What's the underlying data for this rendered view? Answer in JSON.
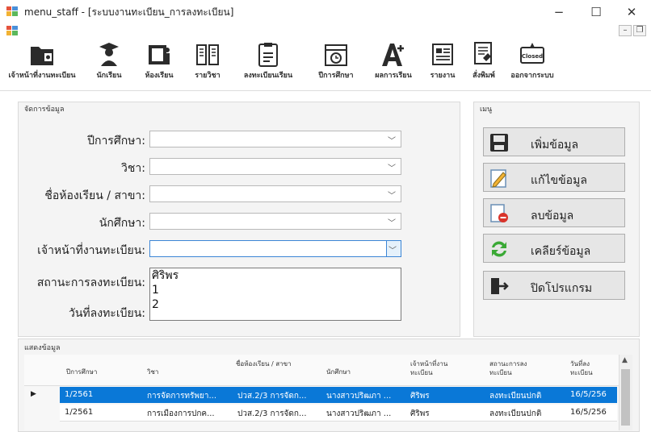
{
  "window": {
    "title": "menu_staff - [ระบบงานทะเบียน_การลงทะเบียน]",
    "minimize": "−",
    "maximize": "☐",
    "close": "✕",
    "mdi_min": "–",
    "mdi_restore": "❐"
  },
  "toolbar": {
    "items": [
      {
        "label": "เจ้าหน้าที่งานทะเบียน",
        "icon": "folder-icon"
      },
      {
        "label": "นักเรียน",
        "icon": "graduate-icon"
      },
      {
        "label": "ห้องเรียน",
        "icon": "classroom-icon"
      },
      {
        "label": "รายวิชา",
        "icon": "book-icon"
      },
      {
        "label": "ลงทะเบียนเรียน",
        "icon": "clipboard-icon"
      },
      {
        "label": "ปีการศึกษา",
        "icon": "calendar-icon"
      },
      {
        "label": "ผลการเรียน",
        "icon": "grade-icon"
      },
      {
        "label": "รายงาน",
        "icon": "report-icon"
      },
      {
        "label": "สั่งพิมพ์",
        "icon": "print-icon"
      },
      {
        "label": "ออกจากระบบ",
        "icon": "closed-sign-icon"
      }
    ],
    "closed_sign_text": "Closed"
  },
  "form": {
    "group_title": "จัดการข้อมูล",
    "fields": [
      {
        "label": "ปีการศึกษา:",
        "value": ""
      },
      {
        "label": "วิชา:",
        "value": ""
      },
      {
        "label": "ชื่อห้องเรียน / สาขา:",
        "value": ""
      },
      {
        "label": "นักศึกษา:",
        "value": ""
      },
      {
        "label": "เจ้าหน้าที่งานทะเบียน:",
        "value": ""
      },
      {
        "label": "สถานะการลงทะเบียน:",
        "value": ""
      },
      {
        "label": "วันที่ลงทะเบียน:",
        "value": ""
      }
    ],
    "dropdown_options": [
      "ศิริพร",
      "1",
      "2"
    ]
  },
  "menu": {
    "group_title": "เมนู",
    "buttons": [
      {
        "label": "เพิ่มข้อมูล",
        "icon": "save-icon"
      },
      {
        "label": "แก้ไขข้อมูล",
        "icon": "edit-icon"
      },
      {
        "label": "ลบข้อมูล",
        "icon": "delete-icon"
      },
      {
        "label": "เคลียร์ข้อมูล",
        "icon": "refresh-icon"
      },
      {
        "label": "ปิดโปรแกรม",
        "icon": "exit-icon"
      }
    ]
  },
  "grid": {
    "group_title": "แสดงข้อมูล",
    "headers": [
      "ปีการศึกษา",
      "วิชา",
      "ชื่อห้องเรียน / สาขา",
      "นักศึกษา",
      "เจ้าหน้าที่งาน ทะเบียน",
      "สถานะการลง ทะเบียน",
      "วันที่ลง ทะเบียน"
    ],
    "rows": [
      {
        "selected": true,
        "cells": [
          "1/2561",
          "การจัดการทรัพยา...",
          "ปวส.2/3 การจัดก...",
          "นางสาวปริฒภา ...",
          "ศิริพร",
          "ลงทะเบียนปกติ",
          "16/5/256"
        ]
      },
      {
        "selected": false,
        "cells": [
          "1/2561",
          "การเมืองการปกค...",
          "ปวส.2/3 การจัดก...",
          "นางสาวปริฒภา ...",
          "ศิริพร",
          "ลงทะเบียนปกติ",
          "16/5/256"
        ]
      }
    ]
  },
  "colors": {
    "selection": "#0a78d7",
    "accent": "#3c86d6",
    "panel": "#f4f4f4"
  }
}
